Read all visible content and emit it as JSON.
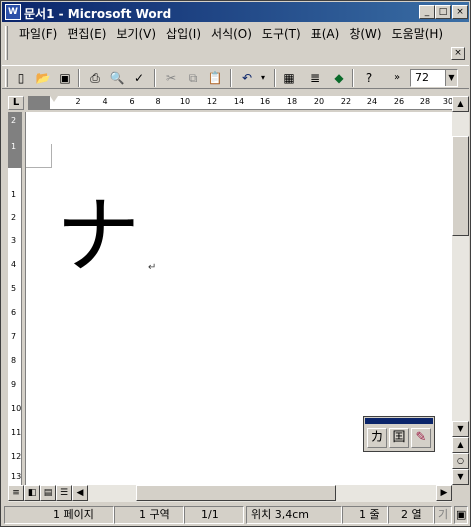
{
  "window": {
    "title": "문서1 - Microsoft Word",
    "icon_label": "W",
    "controls": [
      "_",
      "□",
      "×"
    ]
  },
  "menu": [
    "파일(F)",
    "편집(E)",
    "보기(V)",
    "삽입(I)",
    "서식(O)",
    "도구(T)",
    "표(A)",
    "창(W)",
    "도움말(H)"
  ],
  "toolbar": {
    "zoom_value": "72",
    "icons": [
      "new-icon",
      "open-icon",
      "save-icon",
      "print-icon",
      "print-preview-icon",
      "spelling-icon",
      "cut-icon",
      "copy-icon",
      "paste-icon",
      "undo-icon",
      "table-icon",
      "columns-icon",
      "drawing-icon",
      "help-icon"
    ]
  },
  "ruler": {
    "h_labels": [
      "2",
      "4",
      "6",
      "8",
      "10",
      "12",
      "14",
      "16",
      "18",
      "20",
      "22",
      "24",
      "26",
      "28",
      "30"
    ],
    "v_labels": [
      "2",
      "1",
      "1",
      "2",
      "3",
      "4",
      "5",
      "6",
      "7",
      "8",
      "9",
      "10",
      "11",
      "12",
      "13"
    ]
  },
  "document": {
    "character": "ナ",
    "paragraph_mark": "↵"
  },
  "ime_toolbar": {
    "buttons": [
      "カ",
      "囯",
      "✎"
    ]
  },
  "status": {
    "page": "1 페이지",
    "section": "1 구역",
    "page_of": "1/1",
    "position": "위치 3,4cm",
    "line": "1 줄",
    "column": "2 열",
    "extra": "기"
  }
}
